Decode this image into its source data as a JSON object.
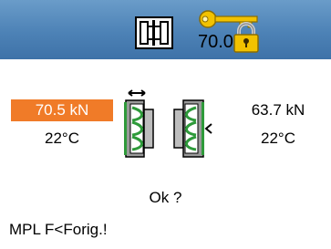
{
  "header": {
    "machine_icon": "clamp-machine-icon",
    "key_icon": "key-icon",
    "lock_icon": "padlock-icon",
    "value": "70.0",
    "background_color": "#4d82b6"
  },
  "left_side": {
    "force": "70.5 kN",
    "temperature": "22°C",
    "highlight_color": "#f07b28"
  },
  "right_side": {
    "force": "63.7 kN",
    "temperature": "22°C"
  },
  "mold": {
    "icon": "mold-halves-icon",
    "accent_color": "#2e9a3a"
  },
  "prompt": "Ok ?",
  "status": "MPL F<Forig.!"
}
